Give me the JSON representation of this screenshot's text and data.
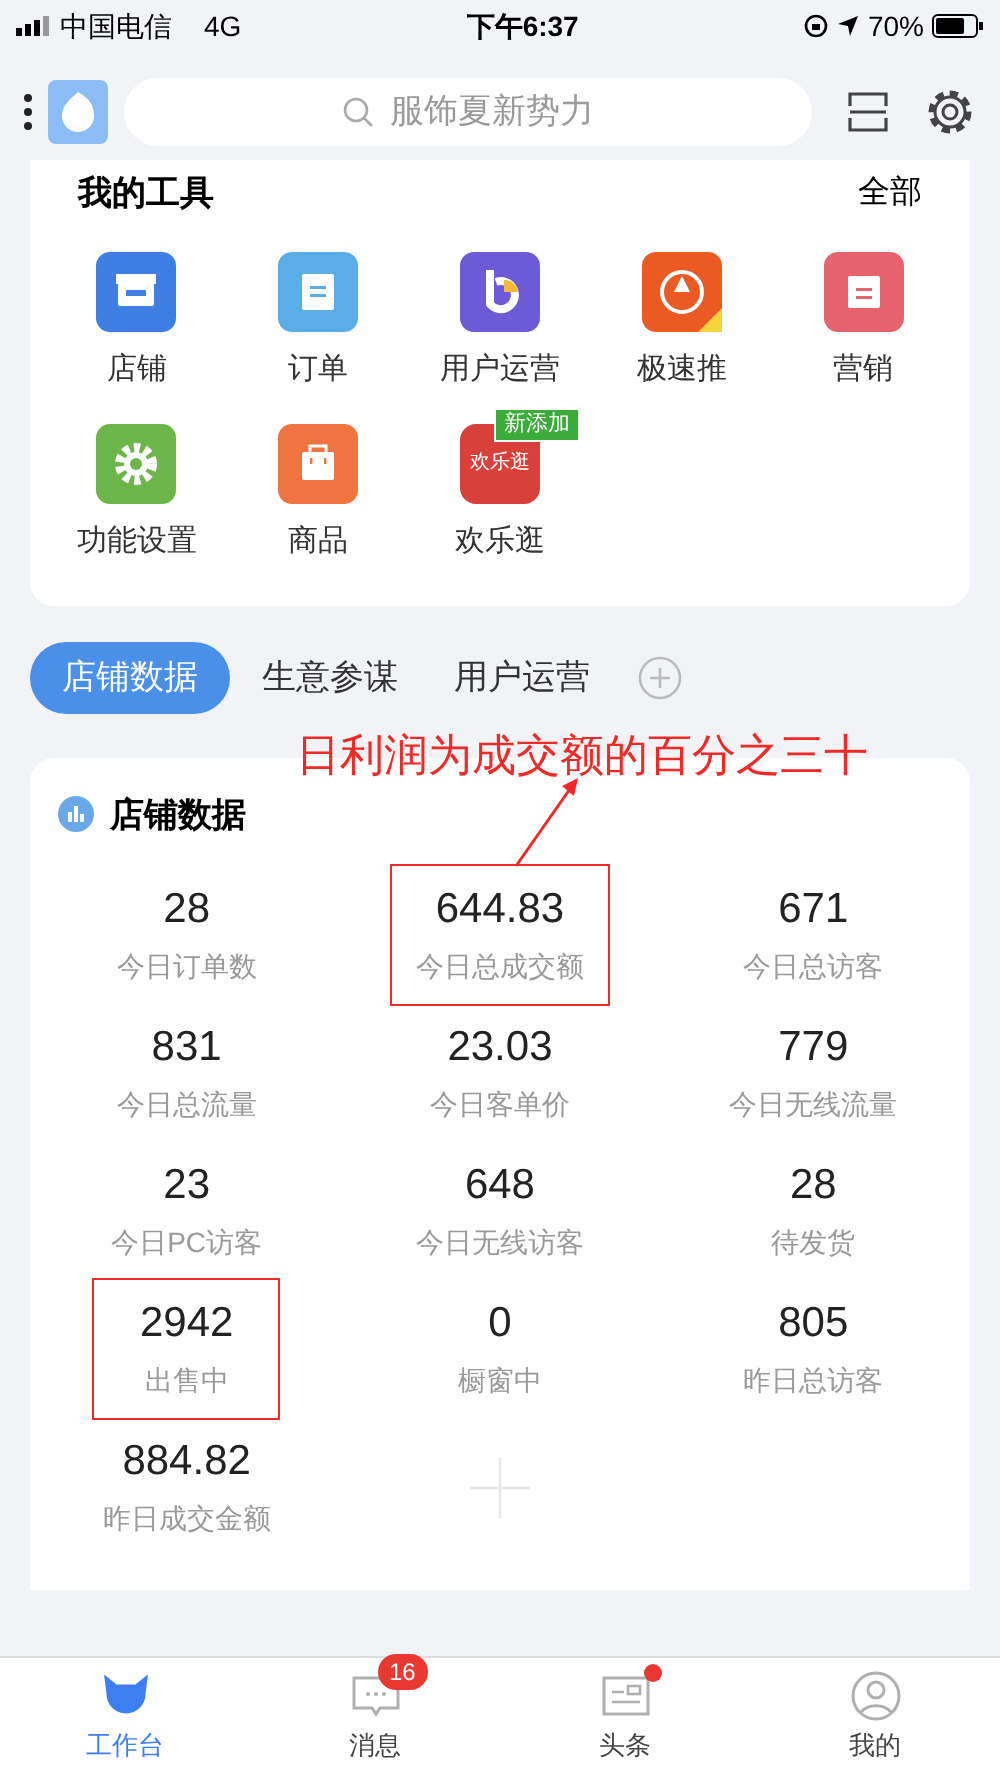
{
  "status_bar": {
    "carrier": "中国电信",
    "network": "4G",
    "time": "下午6:37",
    "battery": "70%"
  },
  "header": {
    "search_placeholder": "服饰夏新势力"
  },
  "tools": {
    "title": "我的工具",
    "more": "全部",
    "items": [
      {
        "label": "店铺",
        "kind": "store",
        "color": "#3f7fe4"
      },
      {
        "label": "订单",
        "kind": "doc",
        "color": "#5aaee8"
      },
      {
        "label": "用户运营",
        "kind": "letter",
        "color": "#6c5ad6"
      },
      {
        "label": "极速推",
        "kind": "rocket",
        "color": "#ec5a24"
      },
      {
        "label": "营销",
        "kind": "box",
        "color": "#e5646d"
      },
      {
        "label": "功能设置",
        "kind": "gear",
        "color": "#6db64c"
      },
      {
        "label": "商品",
        "kind": "bag",
        "color": "#ef7440"
      },
      {
        "label": "欢乐逛",
        "kind": "text",
        "color": "#d9403a",
        "icon_text": "欢乐逛",
        "badge": "新添加"
      }
    ]
  },
  "tabs": [
    {
      "label": "店铺数据",
      "selected": true
    },
    {
      "label": "生意参谋",
      "selected": false
    },
    {
      "label": "用户运营",
      "selected": false
    }
  ],
  "annotation": "日利润为成交额的百分之三十",
  "stats": {
    "title": "店铺数据",
    "items": [
      {
        "kind": "stat",
        "value": "28",
        "label": "今日订单数",
        "highlighted": false
      },
      {
        "kind": "stat",
        "value": "644.83",
        "label": "今日总成交额",
        "highlighted": true
      },
      {
        "kind": "stat",
        "value": "671",
        "label": "今日总访客",
        "highlighted": false
      },
      {
        "kind": "stat",
        "value": "831",
        "label": "今日总流量",
        "highlighted": false
      },
      {
        "kind": "stat",
        "value": "23.03",
        "label": "今日客单价",
        "highlighted": false
      },
      {
        "kind": "stat",
        "value": "779",
        "label": "今日无线流量",
        "highlighted": false
      },
      {
        "kind": "stat",
        "value": "23",
        "label": "今日PC访客",
        "highlighted": false
      },
      {
        "kind": "stat",
        "value": "648",
        "label": "今日无线访客",
        "highlighted": false
      },
      {
        "kind": "stat",
        "value": "28",
        "label": "待发货",
        "highlighted": false
      },
      {
        "kind": "stat",
        "value": "2942",
        "label": "出售中",
        "highlighted": true
      },
      {
        "kind": "stat",
        "value": "0",
        "label": "橱窗中",
        "highlighted": false
      },
      {
        "kind": "stat",
        "value": "805",
        "label": "昨日总访客",
        "highlighted": false
      },
      {
        "kind": "stat",
        "value": "884.82",
        "label": "昨日成交金额",
        "highlighted": false
      },
      {
        "kind": "add"
      }
    ]
  },
  "nav": [
    {
      "label": "工作台",
      "selected": true,
      "kind": "cow"
    },
    {
      "label": "消息",
      "selected": false,
      "kind": "chat",
      "badge": "16"
    },
    {
      "label": "头条",
      "selected": false,
      "kind": "news",
      "dot": true
    },
    {
      "label": "我的",
      "selected": false,
      "kind": "user"
    }
  ]
}
